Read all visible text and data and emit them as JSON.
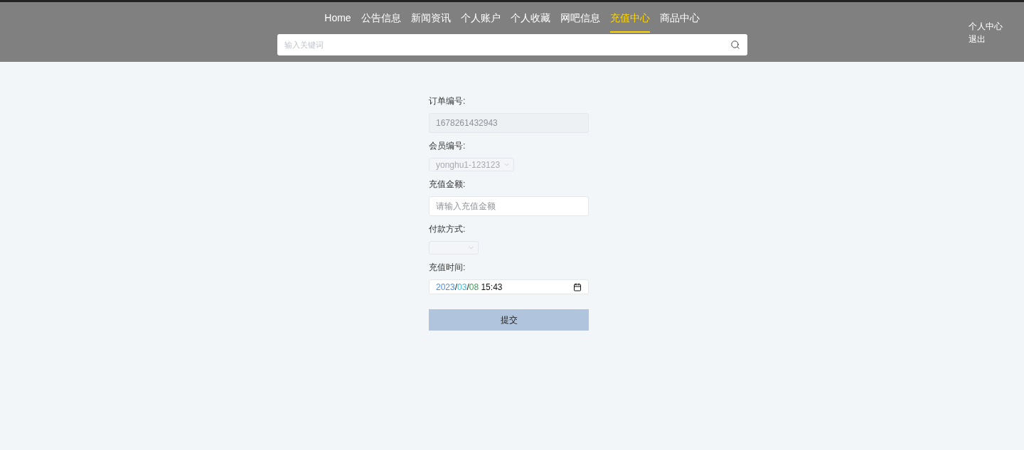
{
  "nav": [
    {
      "label": "Home",
      "selected": false
    },
    {
      "label": "公告信息",
      "selected": false
    },
    {
      "label": "新闻资讯",
      "selected": false
    },
    {
      "label": "个人账户",
      "selected": false
    },
    {
      "label": "个人收藏",
      "selected": false
    },
    {
      "label": "网吧信息",
      "selected": false
    },
    {
      "label": "充值中心",
      "selected": true
    },
    {
      "label": "商品中心",
      "selected": false
    }
  ],
  "search": {
    "placeholder": "输入关键词"
  },
  "user_links": [
    "个人中心",
    "退出"
  ],
  "form": {
    "fields": [
      {
        "kind": "readonly",
        "label": "订单编号:",
        "value": "1678261432943"
      },
      {
        "kind": "select",
        "label": "会员编号:",
        "value": "yonghu1-123123",
        "disabled": true
      },
      {
        "kind": "text",
        "label": "充值金额:",
        "placeholder": "请输入充值金额"
      },
      {
        "kind": "select",
        "label": "付款方式:",
        "disabled": true
      },
      {
        "kind": "datetime",
        "label": "充值时间:",
        "segments": [
          {
            "text": "2023",
            "color": "#4a8fe0"
          },
          {
            "text": "/"
          },
          {
            "text": "03",
            "color": "#3fb8d8"
          },
          {
            "text": "/"
          },
          {
            "text": "08",
            "color": "#2fa84f"
          },
          {
            "text": " 15:43"
          }
        ]
      }
    ],
    "submit": "提交"
  }
}
